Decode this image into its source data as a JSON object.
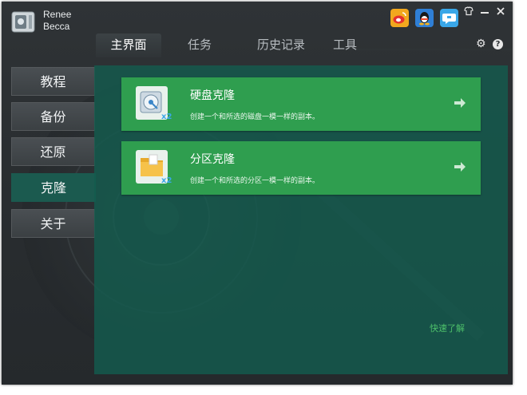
{
  "app": {
    "brand_line1": "Renee",
    "brand_line2": "Becca"
  },
  "tabs": [
    {
      "label": "主界面",
      "active": true
    },
    {
      "label": "任务",
      "active": false
    },
    {
      "label": "历史记录",
      "active": false
    },
    {
      "label": "工具",
      "active": false
    }
  ],
  "sidebar": [
    {
      "label": "教程",
      "active": false
    },
    {
      "label": "备份",
      "active": false
    },
    {
      "label": "还原",
      "active": false
    },
    {
      "label": "克隆",
      "active": true
    },
    {
      "label": "关于",
      "active": false
    }
  ],
  "cards": [
    {
      "title": "硬盘克隆",
      "desc": "创建一个和所选的磁盘一模一样的副本。",
      "badge": "x2",
      "icon": "hard-disk-icon"
    },
    {
      "title": "分区克隆",
      "desc": "创建一个和所选的分区一模一样的副本。",
      "badge": "x2",
      "icon": "folder-icon"
    }
  ],
  "quick_link": "快速了解",
  "help_glyph": "?",
  "icons": {
    "social": [
      "weibo-icon",
      "qq-icon",
      "chat-icon"
    ],
    "window": [
      "shirt-skin-icon",
      "minimize-icon",
      "close-icon"
    ],
    "settings": [
      "gear-icon",
      "help-icon"
    ]
  },
  "colors": {
    "accent_green": "#2f9e4f",
    "panel": "#145c4e",
    "active_sidebar": "#1b5a4f",
    "link": "#4dc06a"
  }
}
